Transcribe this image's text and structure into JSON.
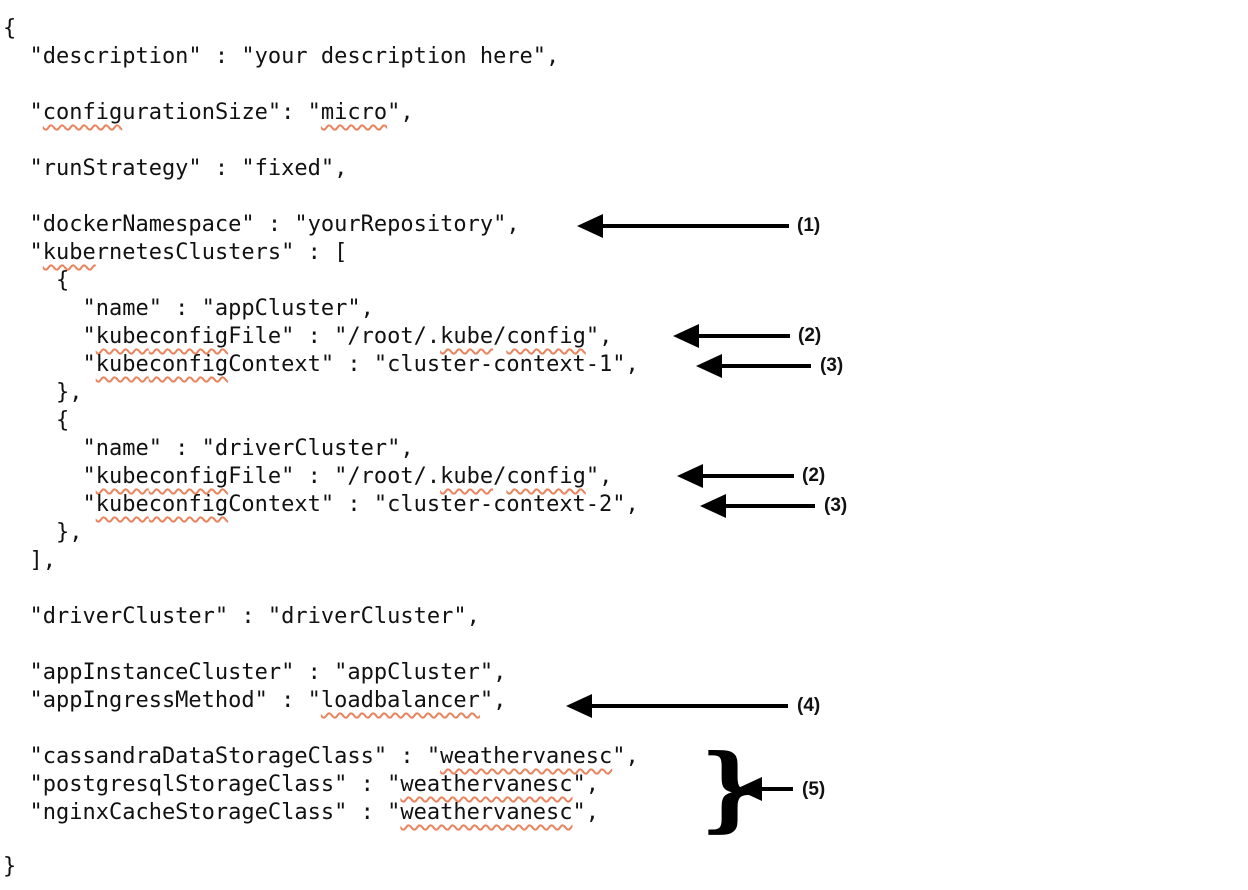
{
  "code_lines": [
    "{",
    "  \"description\" : \"your description here\",",
    "  \"configurationSize\": \"micro\",",
    "  \"runStrategy\" : \"fixed\",",
    "  \"dockerNamespace\" : \"yourRepository\",",
    "  \"kubernetesClusters\" : [",
    "    {",
    "      \"name\" : \"appCluster\",",
    "      \"kubeconfigFile\" : \"/root/.kube/config\",",
    "      \"kubeconfigContext\" : \"cluster-context-1\",",
    "    },",
    "    {",
    "      \"name\" : \"driverCluster\",",
    "      \"kubeconfigFile\" : \"/root/.kube/config\",",
    "      \"kubeconfigContext\" : \"cluster-context-2\",",
    "    },",
    "  ],",
    "  \"driverCluster\" : \"driverCluster\",",
    "  \"appInstanceCluster\" : \"appCluster\",",
    "  \"appIngressMethod\" : \"loadbalancer\",",
    "  \"cassandraDataStorageClass\" : \"weathervanesc\",",
    "  \"postgresqlStorageClass\" : \"weathervanesc\",",
    "  \"nginxCacheStorageClass\" : \"weathervanesc\",",
    "}"
  ],
  "annotations": [
    {
      "label": "(1)"
    },
    {
      "label": "(2)"
    },
    {
      "label": "(3)"
    },
    {
      "label": "(2)"
    },
    {
      "label": "(3)"
    },
    {
      "label": "(4)"
    },
    {
      "label": "(5)"
    }
  ],
  "spellcheck_underline_color": "#e8845e"
}
